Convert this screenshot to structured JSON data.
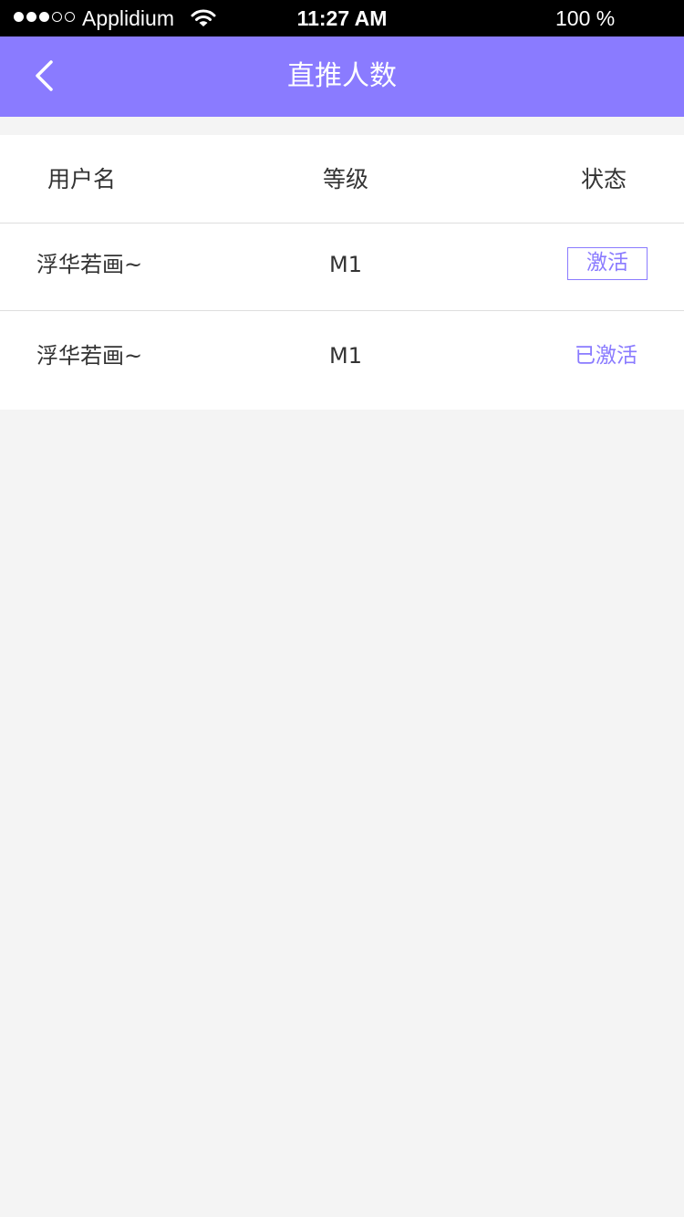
{
  "status_bar": {
    "signal_dots": [
      true,
      true,
      true,
      false,
      false
    ],
    "carrier": "Applidium",
    "wifi_icon": "wifi-icon",
    "time": "11:27 AM",
    "battery": "100 %"
  },
  "nav": {
    "back_icon": "chevron-left-icon",
    "title": "直推人数"
  },
  "table": {
    "columns": {
      "username": "用户名",
      "level": "等级",
      "status": "状态"
    },
    "rows": [
      {
        "username": "浮华若画~",
        "level": "M1",
        "status": "激活",
        "status_type": "button"
      },
      {
        "username": "浮华若画~",
        "level": "M1",
        "status": "已激活",
        "status_type": "text"
      }
    ]
  },
  "colors": {
    "accent": "#8a7bff",
    "status_bar_bg": "#000000",
    "page_bg": "#f4f4f4",
    "divider": "#dedede"
  }
}
